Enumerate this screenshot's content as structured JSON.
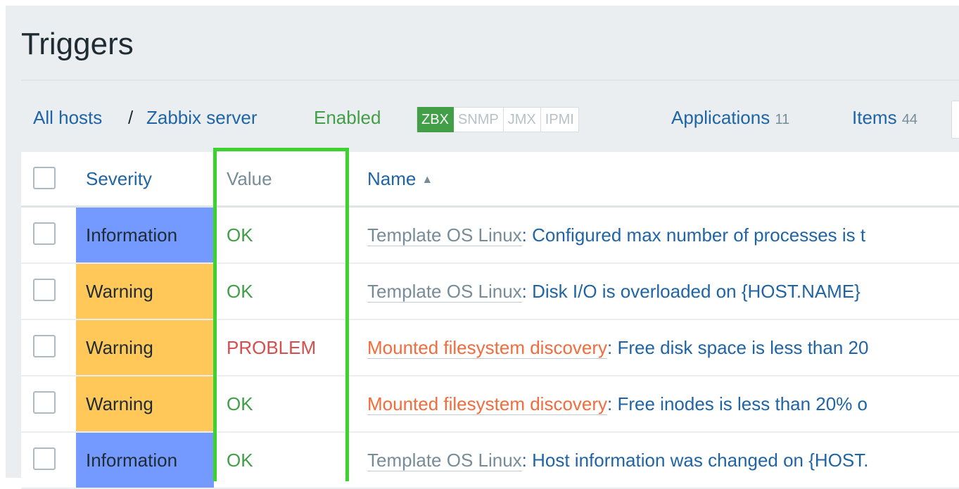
{
  "page": {
    "title": "Triggers"
  },
  "nav": {
    "all_hosts": "All hosts",
    "separator": "/",
    "host": "Zabbix server",
    "status": "Enabled",
    "badges": [
      "ZBX",
      "SNMP",
      "JMX",
      "IPMI"
    ],
    "applications_label": "Applications",
    "applications_count": "11",
    "items_label": "Items",
    "items_count": "44"
  },
  "table": {
    "headers": {
      "severity": "Severity",
      "value": "Value",
      "name": "Name"
    },
    "rows": [
      {
        "severity": "Information",
        "value": "OK",
        "template": "Template OS Linux",
        "name": "Configured max number of processes is t"
      },
      {
        "severity": "Warning",
        "value": "OK",
        "template": "Template OS Linux",
        "name": "Disk I/O is overloaded on {HOST.NAME}"
      },
      {
        "severity": "Warning",
        "value": "PROBLEM",
        "template": "Mounted filesystem discovery",
        "name": "Free disk space is less than 20"
      },
      {
        "severity": "Warning",
        "value": "OK",
        "template": "Mounted filesystem discovery",
        "name": "Free inodes is less than 20% o"
      },
      {
        "severity": "Information",
        "value": "OK",
        "template": "Template OS Linux",
        "name": "Host information was changed on {HOST."
      }
    ]
  },
  "colors": {
    "information": "#7499ff",
    "warning": "#ffc859",
    "ok": "#429e47",
    "problem": "#d64e4e",
    "highlight": "#3dd32e"
  },
  "icons": {
    "sort": "sort-ascending-icon"
  }
}
